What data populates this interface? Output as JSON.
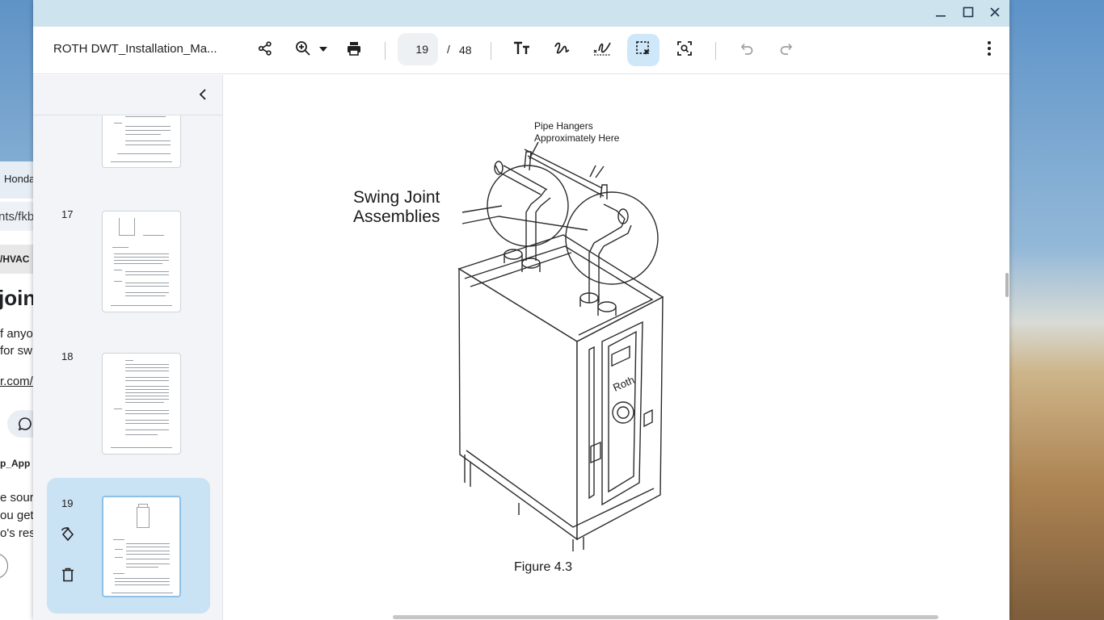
{
  "window": {
    "doc_title": "ROTH DWT_Installation_Ma...",
    "current_page": "19",
    "page_separator": "/",
    "total_pages": "48"
  },
  "toolbar_icons": [
    "share-icon",
    "zoom-in-icon",
    "chevron-down-icon",
    "print-icon",
    "text-icon",
    "draw-icon",
    "signature-icon",
    "select-area-icon",
    "screenshot-search-icon",
    "undo-icon",
    "redo-icon",
    "more-vert-icon"
  ],
  "sidebar": {
    "thumbnails": [
      {
        "page": "17"
      },
      {
        "page": "18"
      },
      {
        "page": "19",
        "selected": true
      }
    ]
  },
  "figure": {
    "label_pipe_hangers_line1": "Pipe Hangers",
    "label_pipe_hangers_line2": "Approximately Here",
    "label_swing_line1": "Swing Joint",
    "label_swing_line2": "Assemblies",
    "caption": "Figure 4.3",
    "tank_logo": "Roth"
  },
  "background_app": {
    "tab_text": "Honda",
    "url_text": "nts/fkb",
    "crumb_text": "/HVAC",
    "heading_text": "joint",
    "body_line1": "f anyo",
    "body_line2": " for sw",
    "link_text": "r.com/",
    "app_label": "p_App",
    "body_line3": "e sourc",
    "body_line4": "ou get",
    "body_line5": "o's res"
  }
}
